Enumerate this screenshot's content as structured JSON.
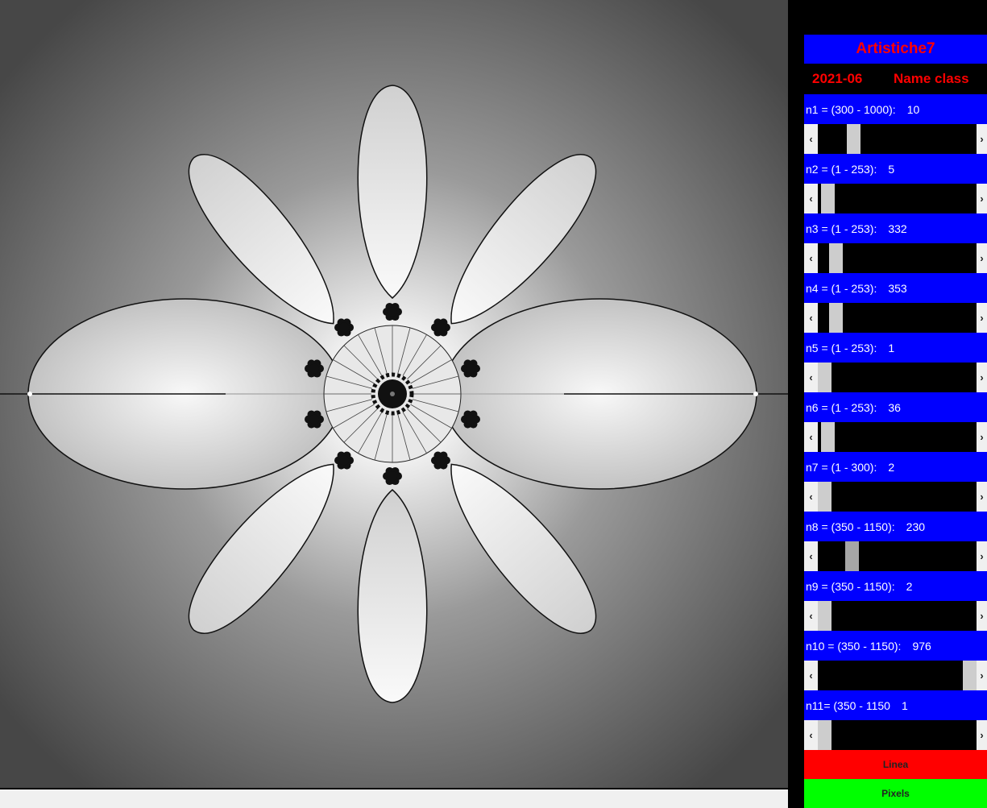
{
  "app": {
    "title": "Artistiche7",
    "date": "2021-06",
    "class_label": "Name class"
  },
  "params": [
    {
      "label": "n1 = (300 - 1000):",
      "value": "10",
      "fraction": 0.2
    },
    {
      "label": "n2 = (1 - 253):",
      "value": "5",
      "fraction": 0.02
    },
    {
      "label": "n3 = (1 - 253):",
      "value": "332",
      "fraction": 0.08
    },
    {
      "label": "n4 = (1 - 253):",
      "value": "353",
      "fraction": 0.08
    },
    {
      "label": "n5 = (1 - 253):",
      "value": "1",
      "fraction": 0.0
    },
    {
      "label": "n6 = (1 - 253):",
      "value": "36",
      "fraction": 0.02
    },
    {
      "label": "n7 = (1 - 300):",
      "value": "2",
      "fraction": 0.0
    },
    {
      "label": "n8 = (350 - 1150):",
      "value": "230",
      "fraction": 0.19
    },
    {
      "label": "n9 = (350 - 1150):",
      "value": "2",
      "fraction": 0.0
    },
    {
      "label": "n10 = (350 - 1150):",
      "value": "976",
      "fraction": 1.0
    },
    {
      "label": "n11= (350 - 1150",
      "value": "1",
      "fraction": 0.0
    }
  ],
  "buttons": {
    "linea": "Linea",
    "pixels": "Pixels"
  },
  "icons": {
    "scroll_left": "chevron-left-icon",
    "scroll_right": "chevron-right-icon"
  },
  "colors": {
    "header_bg": "#0000ff",
    "title_text": "#ff0000",
    "linea_bg": "#ff0000",
    "pixels_bg": "#00ff00"
  }
}
